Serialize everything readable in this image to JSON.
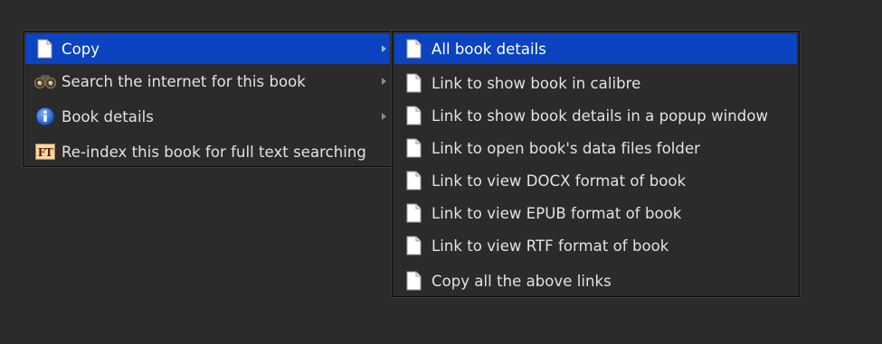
{
  "main_menu": {
    "items": [
      {
        "icon": "copy-icon",
        "label": "Copy",
        "has_submenu": true,
        "active": true
      },
      {
        "icon": "binoculars-icon",
        "label": "Search the internet for this book",
        "has_submenu": true,
        "active": false
      },
      {
        "icon": "info-icon",
        "label": "Book details",
        "has_submenu": true,
        "active": false
      },
      {
        "icon": "full-text-icon",
        "icon_text": "FT",
        "label": "Re-index this book for full text searching",
        "has_submenu": false,
        "active": false
      }
    ]
  },
  "sub_menu": {
    "items": [
      {
        "icon": "copy-icon",
        "label": "All book details",
        "active": true
      },
      {
        "icon": "copy-icon",
        "label": "Link to show book in calibre",
        "active": false
      },
      {
        "icon": "copy-icon",
        "label": "Link to show book details in a popup window",
        "active": false
      },
      {
        "icon": "copy-icon",
        "label": "Link to open book's data files folder",
        "active": false
      },
      {
        "icon": "copy-icon",
        "label": "Link to view DOCX format of book",
        "active": false
      },
      {
        "icon": "copy-icon",
        "label": "Link to view EPUB format of book",
        "active": false
      },
      {
        "icon": "copy-icon",
        "label": "Link to view RTF format of book",
        "active": false
      },
      {
        "icon": "copy-icon",
        "label": "Copy all the above links",
        "active": false
      }
    ]
  },
  "colors": {
    "background": "#2b2b2b",
    "highlight": "#0b43c0",
    "text": "#e3e3e3"
  }
}
